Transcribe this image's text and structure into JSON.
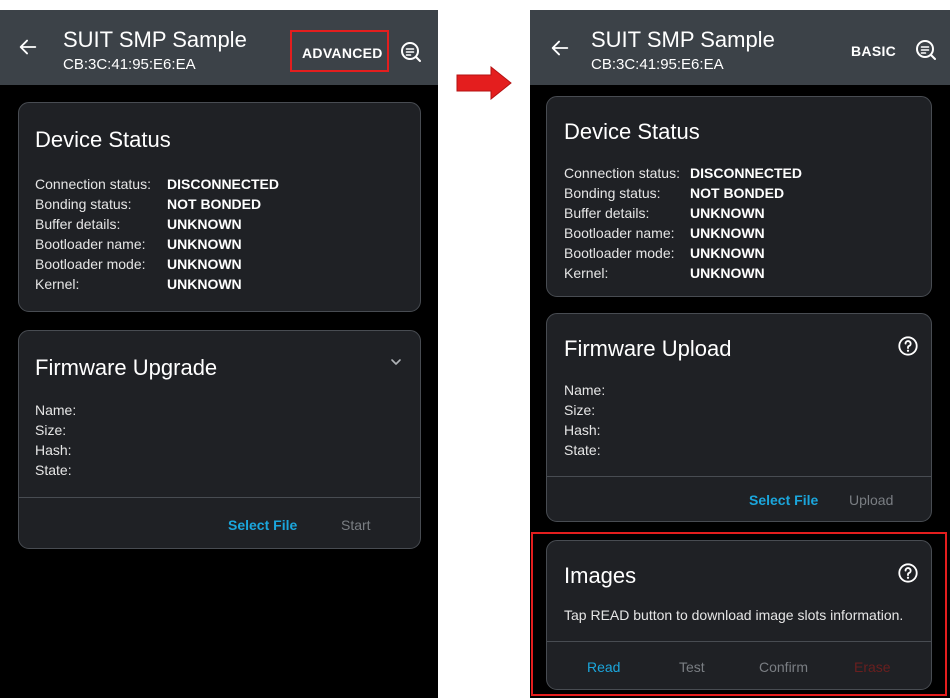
{
  "left": {
    "title": "SUIT SMP Sample",
    "subtitle": "CB:3C:41:95:E6:EA",
    "mode_button": "ADVANCED",
    "device_status": {
      "title": "Device Status",
      "rows": [
        {
          "label": "Connection status:",
          "value": "DISCONNECTED"
        },
        {
          "label": "Bonding status:",
          "value": "NOT BONDED"
        },
        {
          "label": "Buffer details:",
          "value": "UNKNOWN"
        },
        {
          "label": "Bootloader name:",
          "value": "UNKNOWN"
        },
        {
          "label": "Bootloader mode:",
          "value": "UNKNOWN"
        },
        {
          "label": "Kernel:",
          "value": "UNKNOWN"
        }
      ]
    },
    "firmware": {
      "title": "Firmware Upgrade",
      "fields": [
        "Name:",
        "Size:",
        "Hash:",
        "State:"
      ],
      "select_file": "Select File",
      "start": "Start"
    }
  },
  "right": {
    "title": "SUIT SMP Sample",
    "subtitle": "CB:3C:41:95:E6:EA",
    "mode_button": "BASIC",
    "device_status": {
      "title": "Device Status",
      "rows": [
        {
          "label": "Connection status:",
          "value": "DISCONNECTED"
        },
        {
          "label": "Bonding status:",
          "value": "NOT BONDED"
        },
        {
          "label": "Buffer details:",
          "value": "UNKNOWN"
        },
        {
          "label": "Bootloader name:",
          "value": "UNKNOWN"
        },
        {
          "label": "Bootloader mode:",
          "value": "UNKNOWN"
        },
        {
          "label": "Kernel:",
          "value": "UNKNOWN"
        }
      ]
    },
    "firmware": {
      "title": "Firmware Upload",
      "fields": [
        "Name:",
        "Size:",
        "Hash:",
        "State:"
      ],
      "select_file": "Select File",
      "upload": "Upload"
    },
    "images": {
      "title": "Images",
      "info": "Tap READ button to download image slots information.",
      "read": "Read",
      "test": "Test",
      "confirm": "Confirm",
      "erase": "Erase"
    }
  },
  "icons": {
    "back": "back-arrow-icon",
    "log": "log-search-icon",
    "help": "help-circle-icon",
    "chevron": "chevron-down-icon",
    "transition": "right-arrow-icon"
  },
  "colors": {
    "appbar": "#3c4248",
    "card": "#1f2125",
    "accent": "#1ba6dc",
    "highlight": "#e41e1e"
  }
}
